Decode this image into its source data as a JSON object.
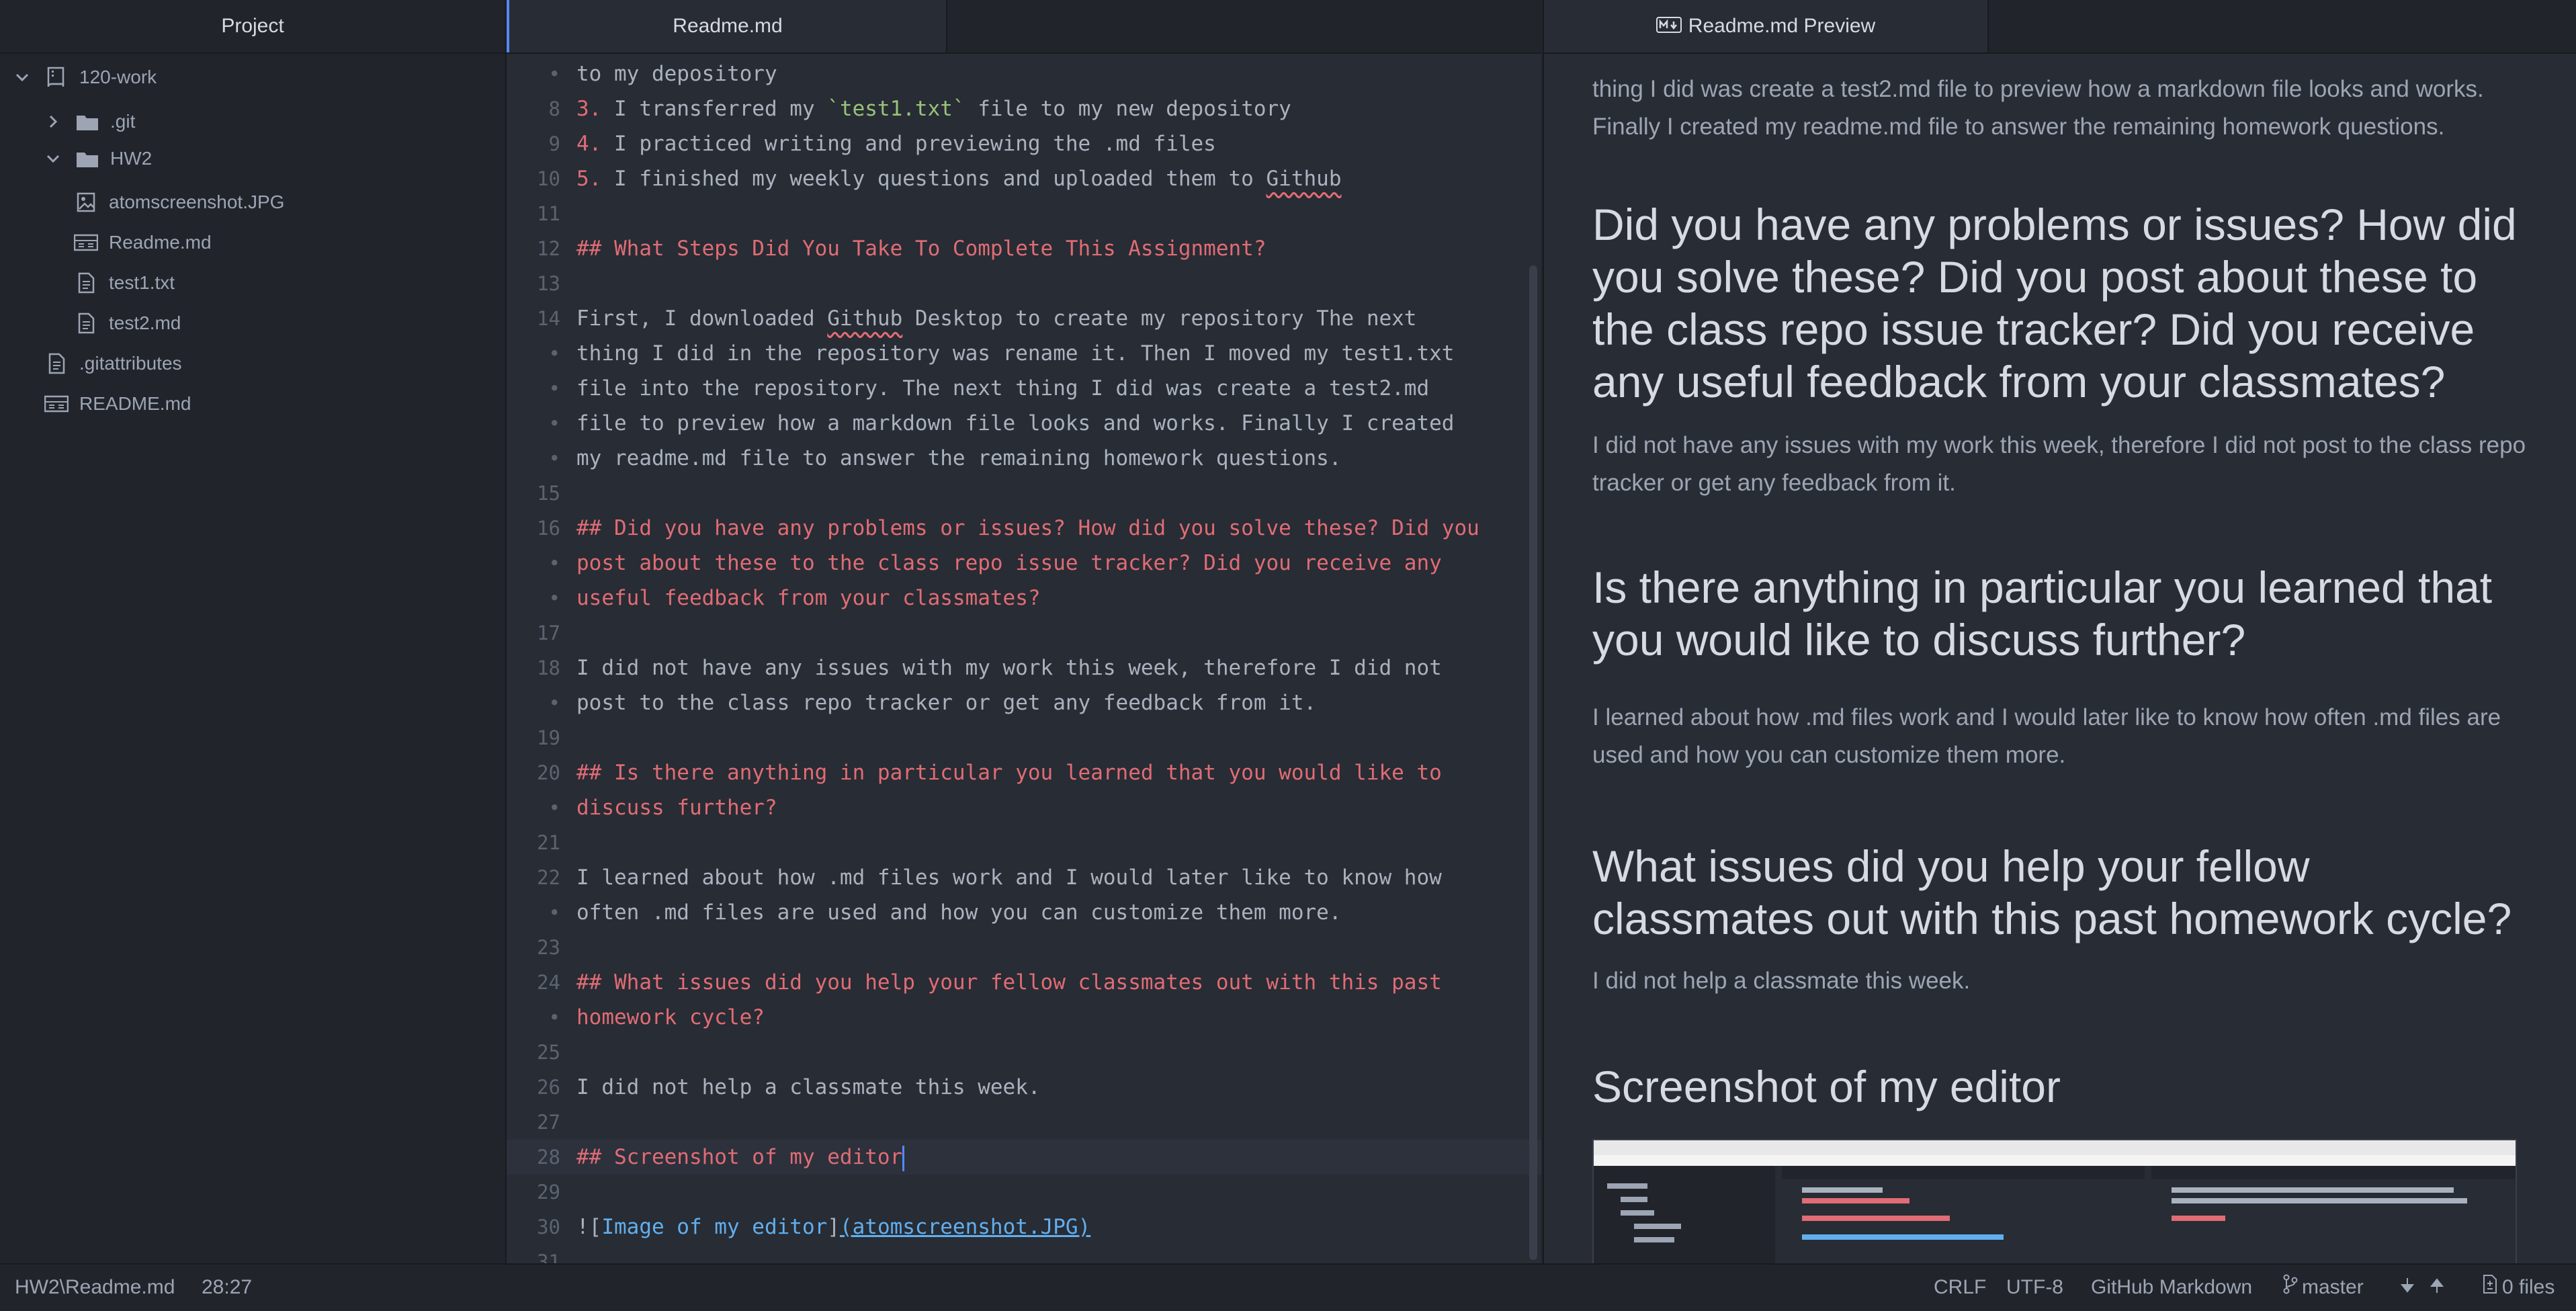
{
  "sidebar": {
    "title": "Project",
    "tree": [
      {
        "label": "120-work",
        "icon": "repo-icon",
        "chevron": "down"
      },
      {
        "label": ".git",
        "icon": "folder-icon",
        "chevron": "right"
      },
      {
        "label": "HW2",
        "icon": "folder-icon",
        "chevron": "down"
      },
      {
        "label": "atomscreenshot.JPG",
        "icon": "image-file-icon"
      },
      {
        "label": "Readme.md",
        "icon": "markdown-file-icon"
      },
      {
        "label": "test1.txt",
        "icon": "text-file-icon"
      },
      {
        "label": "test2.md",
        "icon": "text-file-icon"
      },
      {
        "label": ".gitattributes",
        "icon": "text-file-icon"
      },
      {
        "label": "README.md",
        "icon": "markdown-file-icon"
      }
    ]
  },
  "editor": {
    "tab_title": "Readme.md",
    "lines": [
      {
        "n": "•",
        "text": "to my depository"
      },
      {
        "n": "8",
        "num": "3.",
        "pre": " I transferred my ",
        "code": "`test1.txt`",
        "post": " file to my new depository"
      },
      {
        "n": "9",
        "num": "4.",
        "post": " I practiced writing and previewing the .md files"
      },
      {
        "n": "10",
        "num": "5.",
        "post": " I finished my weekly questions and uploaded them to ",
        "spell": "Github"
      },
      {
        "n": "11",
        "text": ""
      },
      {
        "n": "12",
        "heading": "## What Steps Did You Take To Complete This Assignment?"
      },
      {
        "n": "13",
        "text": ""
      },
      {
        "n": "14",
        "pre": "First, I downloaded ",
        "spell": "Github",
        "post": " Desktop to create my repository The next"
      },
      {
        "n": "•",
        "text": "thing I did in the repository was rename it. Then I moved my test1.txt"
      },
      {
        "n": "•",
        "text": "file into the repository. The next thing I did was create a test2.md"
      },
      {
        "n": "•",
        "text": "file to preview how a markdown file looks and works. Finally I created"
      },
      {
        "n": "•",
        "text": "my readme.md file to answer the remaining homework questions."
      },
      {
        "n": "15",
        "text": ""
      },
      {
        "n": "16",
        "heading": "## Did you have any problems or issues? How did you solve these? Did you"
      },
      {
        "n": "•",
        "heading": "post about these to the class repo issue tracker? Did you receive any"
      },
      {
        "n": "•",
        "heading": "useful feedback from your classmates?"
      },
      {
        "n": "17",
        "text": ""
      },
      {
        "n": "18",
        "text": "I did not have any issues with my work this week, therefore I did not"
      },
      {
        "n": "•",
        "text": "post to the class repo tracker or get any feedback from it."
      },
      {
        "n": "19",
        "text": ""
      },
      {
        "n": "20",
        "heading": "## Is there anything in particular you learned that you would like to"
      },
      {
        "n": "•",
        "heading": "discuss further?"
      },
      {
        "n": "21",
        "text": ""
      },
      {
        "n": "22",
        "text": "I learned about how .md files work and I would later like to know how"
      },
      {
        "n": "•",
        "text": "often .md files are used and how you can customize them more."
      },
      {
        "n": "23",
        "text": ""
      },
      {
        "n": "24",
        "heading": "## What issues did you help your fellow classmates out with this past"
      },
      {
        "n": "•",
        "heading": "homework cycle?"
      },
      {
        "n": "25",
        "text": ""
      },
      {
        "n": "26",
        "text": "I did not help a classmate this week."
      },
      {
        "n": "27",
        "text": ""
      },
      {
        "n": "28",
        "heading": "## Screenshot of my editor",
        "cursor": true
      },
      {
        "n": "29",
        "text": ""
      },
      {
        "n": "30",
        "img_pre": "![",
        "img_alt": "Image of my editor",
        "img_mid": "]",
        "img_url": "(atomscreenshot.JPG)"
      },
      {
        "n": "31",
        "text": ""
      }
    ]
  },
  "preview": {
    "tab_title": "Readme.md Preview",
    "blocks": [
      {
        "type": "p",
        "text": "thing I did was create a test2.md file to preview how a markdown file looks and works. Finally I created my readme.md file to answer the remaining homework questions."
      },
      {
        "type": "h2",
        "text": "Did you have any problems or issues? How did you solve these? Did you post about these to the class repo issue tracker? Did you receive any useful feedback from your classmates?"
      },
      {
        "type": "p",
        "text": "I did not have any issues with my work this week, therefore I did not post to the class repo tracker or get any feedback from it."
      },
      {
        "type": "h2",
        "text": "Is there anything in particular you learned that you would like to discuss further?"
      },
      {
        "type": "p",
        "text": "I learned about how .md files work and I would later like to know how often .md files are used and how you can customize them more."
      },
      {
        "type": "h2",
        "text": "What issues did you help your fellow classmates out with this past homework cycle?"
      },
      {
        "type": "p",
        "text": "I did not help a classmate this week."
      },
      {
        "type": "h2",
        "text": "Screenshot of my editor"
      }
    ]
  },
  "statusbar": {
    "file_path": "HW2\\Readme.md",
    "cursor_pos": "28:27",
    "line_ending": "CRLF",
    "encoding": "UTF-8",
    "grammar": "GitHub Markdown",
    "branch": "master",
    "files_count": "0 files"
  },
  "colors": {
    "background": "#282c34",
    "heading": "#e06c75",
    "accent": "#568af2"
  }
}
